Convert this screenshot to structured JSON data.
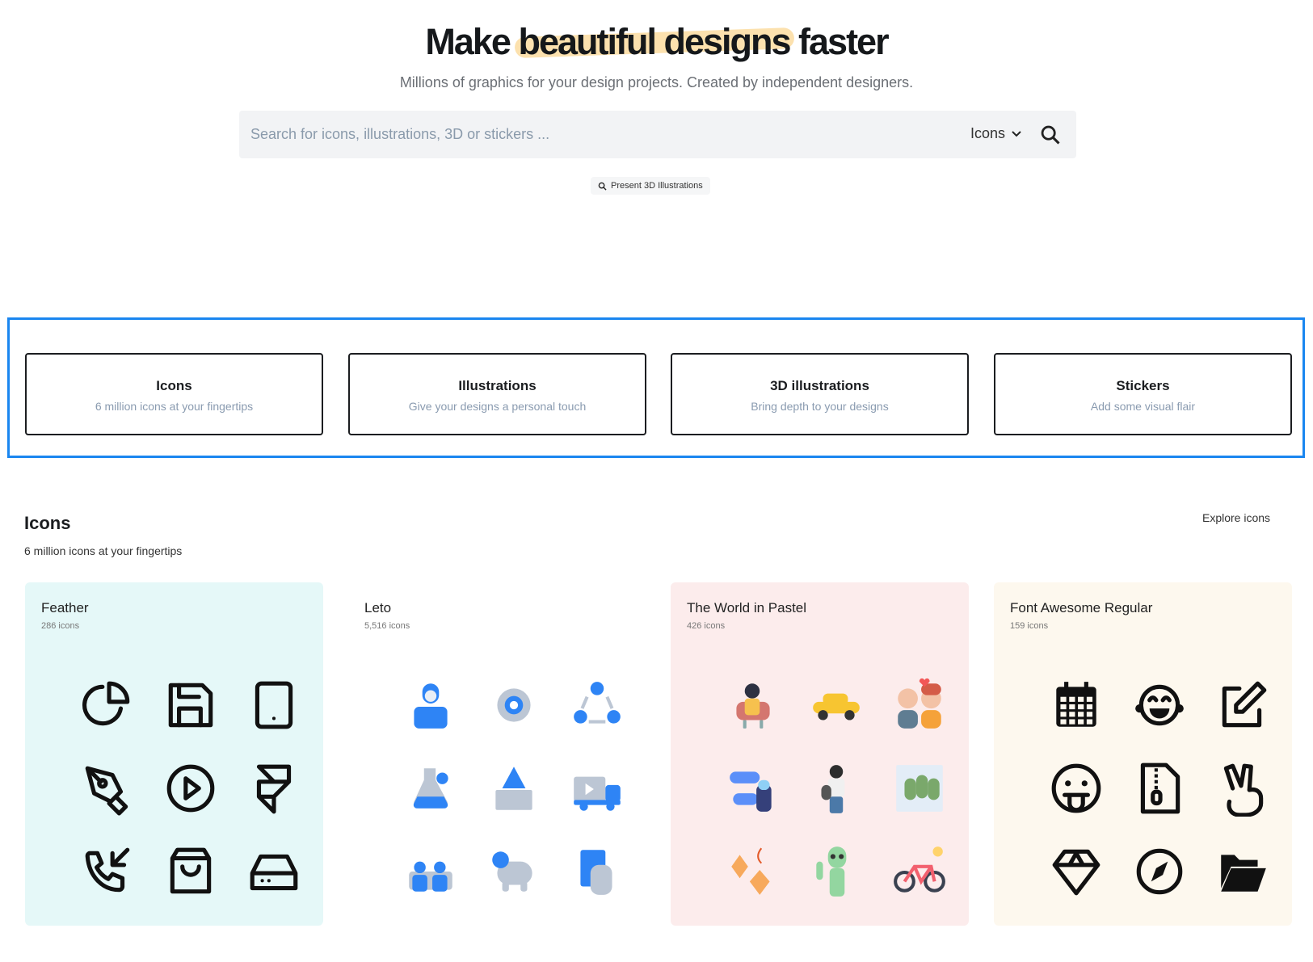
{
  "hero": {
    "title_pre": "Make",
    "title_highlight": "beautiful designs",
    "title_post": "faster",
    "subtitle": "Millions of graphics for your design projects. Created by independent designers."
  },
  "search": {
    "placeholder": "Search for icons, illustrations, 3D or stickers ...",
    "value": "",
    "type": "Icons",
    "suggestion": "Present 3D Illustrations"
  },
  "categories": [
    {
      "title": "Icons",
      "subtitle": "6 million icons at your fingertips"
    },
    {
      "title": "Illustrations",
      "subtitle": "Give your designs a personal touch"
    },
    {
      "title": "3D illustrations",
      "subtitle": "Bring depth to your designs"
    },
    {
      "title": "Stickers",
      "subtitle": "Add some visual flair"
    }
  ],
  "icons_section": {
    "title": "Icons",
    "subtitle": "6 million icons at your fingertips",
    "explore": "Explore icons"
  },
  "collections": [
    {
      "name": "Feather",
      "count": "286 icons",
      "bg": "#e5f8f8",
      "icons": [
        "pie-chart",
        "save",
        "tablet",
        "pen-tool",
        "play-circle",
        "framer",
        "phone-incoming",
        "shopping-bag",
        "hard-drive"
      ]
    },
    {
      "name": "Leto",
      "count": "5,516 icons",
      "bg": "#ffffff",
      "icons": [
        "user",
        "settings",
        "network",
        "flask",
        "mountain-wall",
        "truck-video",
        "team",
        "map-pig",
        "credit-card"
      ]
    },
    {
      "name": "The World in Pastel",
      "count": "426 icons",
      "bg": "#fcecec",
      "icons": [
        "person-chair",
        "taxi",
        "couple",
        "diver-sharks",
        "woman-bag",
        "rain-trees",
        "leaves",
        "alien",
        "bicycle"
      ]
    },
    {
      "name": "Font Awesome Regular",
      "count": "159 icons",
      "bg": "#fdf8ee",
      "icons": [
        "calendar",
        "laugh",
        "edit",
        "tongue",
        "file-zip",
        "peace-hand",
        "gem",
        "compass",
        "folder-open"
      ]
    }
  ],
  "colors": {
    "accent": "#1a86f0",
    "highlight": "#fcdca0",
    "leto_blue": "#2e84f5"
  }
}
